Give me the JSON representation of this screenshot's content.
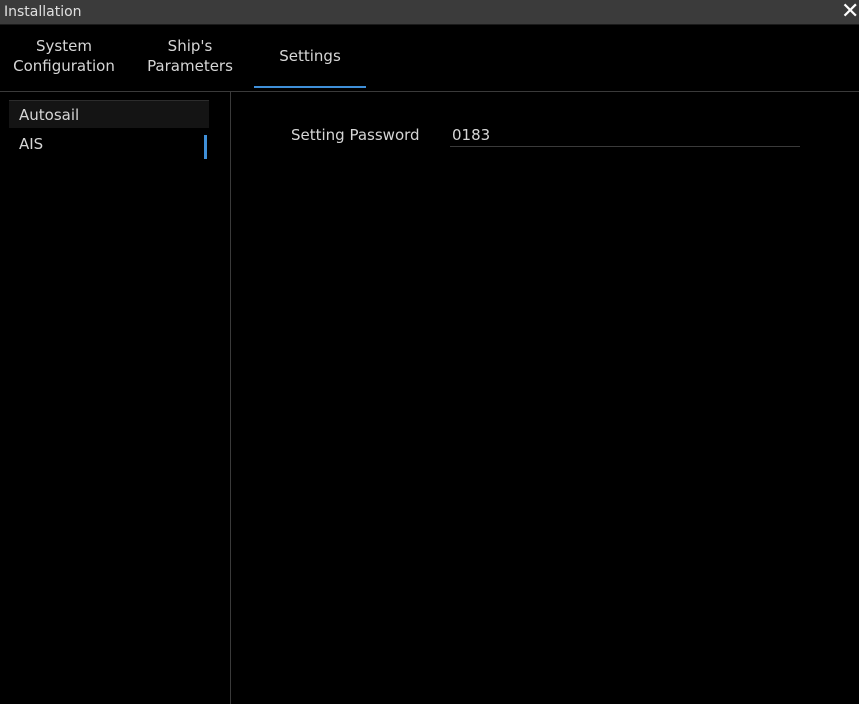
{
  "window": {
    "title": "Installation",
    "close_glyph": "✕"
  },
  "tabs": [
    {
      "line1": "System",
      "line2": "Configuration"
    },
    {
      "line1": "Ship's",
      "line2": "Parameters"
    },
    {
      "line1": "Settings"
    }
  ],
  "active_tab_index": 2,
  "sidebar": {
    "items": [
      {
        "label": "Autosail"
      },
      {
        "label": "AIS"
      }
    ]
  },
  "main": {
    "password_label": "Setting Password",
    "password_value": "0183"
  },
  "colors": {
    "accent": "#3f8fd8",
    "background": "#000000",
    "titlebar": "#3b3b3b",
    "text": "#d6d6d6"
  }
}
